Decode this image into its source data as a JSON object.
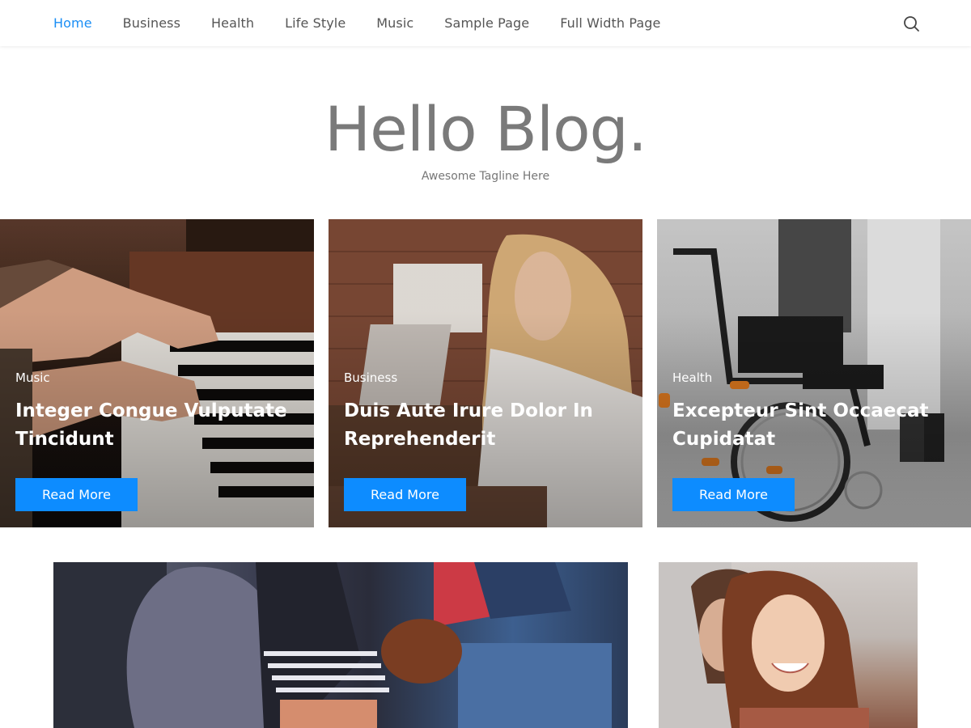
{
  "nav": {
    "items": [
      {
        "label": "Home",
        "active": true
      },
      {
        "label": "Business",
        "active": false
      },
      {
        "label": "Health",
        "active": false
      },
      {
        "label": "Life Style",
        "active": false
      },
      {
        "label": "Music",
        "active": false
      },
      {
        "label": "Sample Page",
        "active": false
      },
      {
        "label": "Full Width Page",
        "active": false
      }
    ],
    "search_icon": "search-icon"
  },
  "brand": {
    "title": "Hello Blog.",
    "tagline": "Awesome Tagline Here"
  },
  "featured": [
    {
      "category": "Music",
      "title": "Integer Congue Vulputate Tincidunt",
      "button": "Read More",
      "image": "piano-hands"
    },
    {
      "category": "Business",
      "title": "Duis Aute Irure Dolor In Reprehenderit",
      "button": "Read More",
      "image": "woman-laptop-office"
    },
    {
      "category": "Health",
      "title": "Excepteur Sint Occaecat Cupidatat",
      "button": "Read More",
      "image": "wheelchair-clinic"
    }
  ],
  "posts": [
    {
      "image": "family-couch-dog"
    },
    {
      "image": "smiling-couple"
    }
  ],
  "colors": {
    "accent": "#0d8cff",
    "nav_active": "#1a8ef5",
    "title": "#7a7a7a"
  }
}
